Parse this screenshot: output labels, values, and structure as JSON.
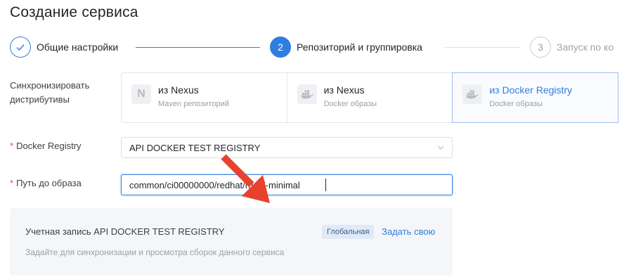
{
  "page": {
    "title": "Создание сервиса"
  },
  "steps": [
    {
      "number": "1",
      "label": "Общие настройки",
      "state": "done"
    },
    {
      "number": "2",
      "label": "Репозиторий и группировка",
      "state": "active"
    },
    {
      "number": "3",
      "label": "Запуск по ко",
      "state": "pending"
    }
  ],
  "form": {
    "sync_label": "Синхронизировать дистрибутивы",
    "registry_label": "Docker Registry",
    "image_path_label": "Путь до образа",
    "required_mark": "*"
  },
  "sources": [
    {
      "icon": "nexus-icon",
      "icon_letter": "N",
      "title": "из Nexus",
      "subtitle": "Maven репозиторий",
      "selected": false
    },
    {
      "icon": "docker-icon",
      "title": "из Nexus",
      "subtitle": "Docker образы",
      "selected": false
    },
    {
      "icon": "docker-icon",
      "title": "из Docker Registry",
      "subtitle": "Docker образы",
      "selected": true
    }
  ],
  "registry_select": {
    "value": "API DOCKER TEST REGISTRY"
  },
  "image_path_input": {
    "value": "common/ci00000000/redhat/rhel7-minimal"
  },
  "account_panel": {
    "title": "Учетная запись API DOCKER TEST REGISTRY",
    "badge": "Глобальная",
    "link": "Задать свою",
    "description": "Задайте для синхронизации и просмотра сборок данного сервиса"
  },
  "colors": {
    "accent": "#2f7de1",
    "annotation_arrow": "#e8412c"
  }
}
